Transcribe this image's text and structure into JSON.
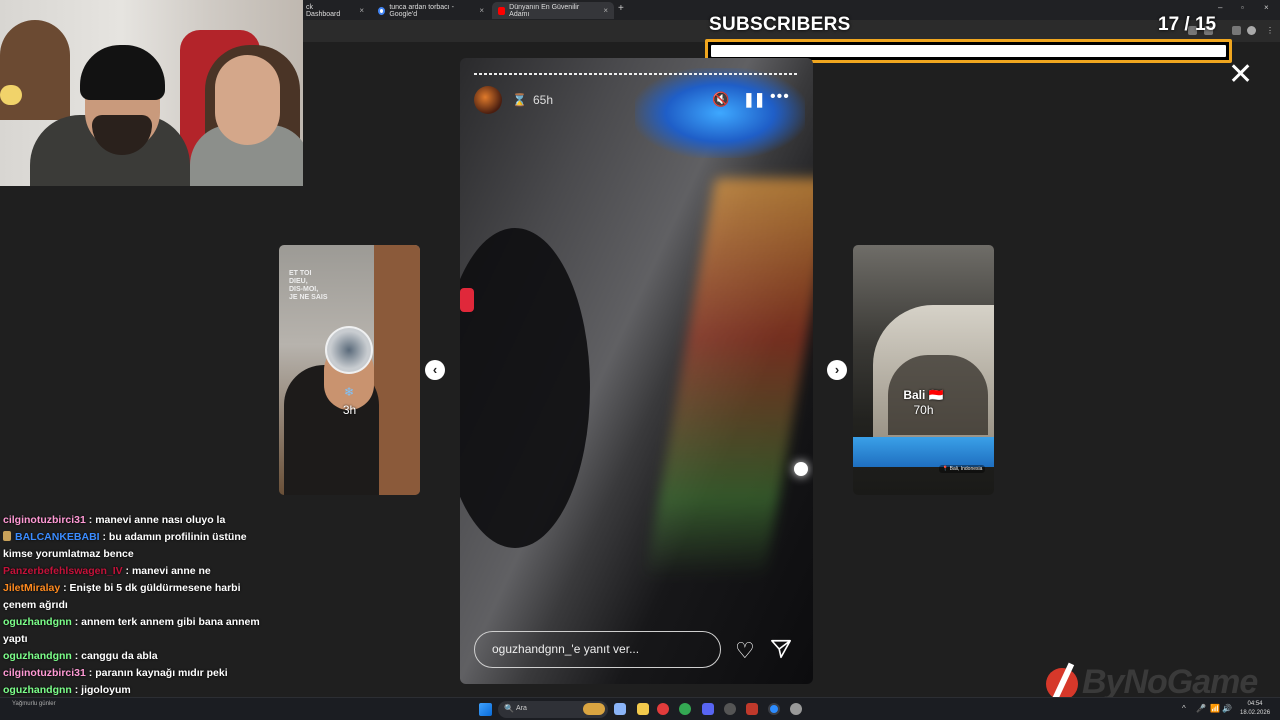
{
  "browser": {
    "tabs": [
      {
        "title": "ck Dashboard",
        "color": "#888888"
      },
      {
        "title": "tunca ardan torbacı - Google'd",
        "color": "#4285f4"
      },
      {
        "title": "Dünyanın En Güvenilir Adamı",
        "color": "#ff0000"
      }
    ],
    "new_tab": "+",
    "tab_close": "×",
    "window_controls": {
      "minimize": "–",
      "maximize": "▫",
      "close": "×"
    }
  },
  "overlay": {
    "subscribers_label": "SUBSCRIBERS",
    "subscribers_count": "17  / 15",
    "progress_fraction": 1.0,
    "bar_color": "#f0a61f"
  },
  "story": {
    "close": "✕",
    "time_ago": "65h",
    "hourglass": "⌛",
    "reply_placeholder": "oguzhandgnn_'e yanıt ver...",
    "mute_icon": "🔇",
    "pause_icon": "❚❚",
    "more_icon": "•••",
    "heart_icon": "♡"
  },
  "preview_left": {
    "overlay_text": "ET TOI\nDIEU,\nDIS-MOI,\nJE NE SAIS",
    "time": "3h",
    "icon": "❄"
  },
  "preview_right": {
    "name": "Bali 🇮🇩",
    "time": "70h",
    "location_tag": "📍 Bali, Indonesia"
  },
  "nav": {
    "prev": "‹",
    "next": "›"
  },
  "chat": [
    {
      "user": "cilginotuzbirci31",
      "color": "#ff9ad5",
      "text": ": manevi anne nası oluyo la",
      "badge": false
    },
    {
      "user": "BALCANKEBABI",
      "color": "#3b8cff",
      "text": ": bu adamın profilinin üstüne kimse yorumlatmaz bence",
      "badge": true
    },
    {
      "user": "Panzerbefehlswagen_IV",
      "color": "#c4123a",
      "text": ": manevi anne ne",
      "badge": false
    },
    {
      "user": "JiletMiralay",
      "color": "#ff8a1f",
      "text": ": Enişte bi 5 dk güldürmesene harbi çenem ağrıdı",
      "badge": false
    },
    {
      "user": "oguzhandgnn",
      "color": "#7cff8a",
      "text": ": annem terk annem gibi bana annem yaptı",
      "badge": false
    },
    {
      "user": "oguzhandgnn",
      "color": "#7cff8a",
      "text": ": canggu da abla",
      "badge": false
    },
    {
      "user": "cilginotuzbirci31",
      "color": "#ff9ad5",
      "text": ": paranın kaynağı mıdır peki",
      "badge": false
    },
    {
      "user": "oguzhandgnn",
      "color": "#7cff8a",
      "text": ": jigoloyum",
      "badge": false
    }
  ],
  "watermark": {
    "text": "ByNoGame"
  },
  "taskbar": {
    "search_placeholder": "Ara",
    "search_icon": "🔍",
    "time": "04:54",
    "date": "18.02.2026",
    "tray_up": "^",
    "tray_mic": "🎤",
    "tray_wifi": "📶",
    "tray_volume": "🔊",
    "tray_battery": "🔋",
    "small_label": "Yağmurlu günler"
  }
}
